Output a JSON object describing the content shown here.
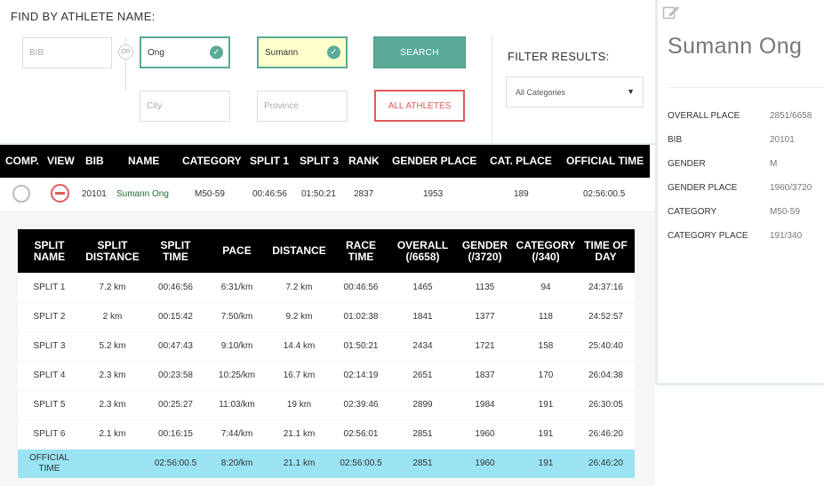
{
  "search": {
    "title": "FIND BY ATHLETE NAME:",
    "bib_placeholder": "BIB",
    "or_label": "OR",
    "last_name_value": "Ong",
    "first_name_value": "Sumann",
    "city_placeholder": "City",
    "province_placeholder": "Province",
    "search_button": "SEARCH",
    "all_athletes_button": "ALL ATHLETES"
  },
  "filter": {
    "title": "FILTER RESULTS:",
    "selected": "All Categories"
  },
  "results": {
    "headers": [
      "COMP.",
      "VIEW",
      "BIB",
      "NAME",
      "CATEGORY",
      "SPLIT 1",
      "SPLIT 3",
      "RANK",
      "GENDER PLACE",
      "CAT. PLACE",
      "OFFICIAL TIME"
    ],
    "row": {
      "bib": "20101",
      "name": "Sumann Ong",
      "category": "M50-59",
      "split1": "00:46:56",
      "split3": "01:50:21",
      "rank": "2837",
      "gender_place": "1953",
      "cat_place": "189",
      "official_time": "02:56:00.5"
    }
  },
  "splits": {
    "headers": [
      [
        "SPLIT",
        "NAME"
      ],
      [
        "SPLIT",
        "DISTANCE"
      ],
      [
        "SPLIT",
        "TIME"
      ],
      [
        "PACE"
      ],
      [
        "DISTANCE"
      ],
      [
        "RACE",
        "TIME"
      ],
      [
        "OVERALL",
        "(/6658)"
      ],
      [
        "GENDER",
        "(/3720)"
      ],
      [
        "CATEGORY",
        "(/340)"
      ],
      [
        "TIME OF",
        "DAY"
      ]
    ],
    "rows": [
      [
        "SPLIT 1",
        "7.2 km",
        "00:46:56",
        "6:31/km",
        "7.2 km",
        "00:46:56",
        "1465",
        "1135",
        "94",
        "24:37:16"
      ],
      [
        "SPLIT 2",
        "2 km",
        "00:15:42",
        "7:50/km",
        "9.2 km",
        "01:02:38",
        "1841",
        "1377",
        "118",
        "24:52:57"
      ],
      [
        "SPLIT 3",
        "5.2 km",
        "00:47:43",
        "9:10/km",
        "14.4 km",
        "01:50:21",
        "2434",
        "1721",
        "158",
        "25:40:40"
      ],
      [
        "SPLIT 4",
        "2.3 km",
        "00:23:58",
        "10:25/km",
        "16.7 km",
        "02:14:19",
        "2651",
        "1837",
        "170",
        "26:04:38"
      ],
      [
        "SPLIT 5",
        "2.3 km",
        "00:25:27",
        "11:03/km",
        "19 km",
        "02:39:46",
        "2899",
        "1984",
        "191",
        "26:30:05"
      ],
      [
        "SPLIT 6",
        "2.1 km",
        "00:16:15",
        "7:44/km",
        "21.1 km",
        "02:56:01",
        "2851",
        "1960",
        "191",
        "26:46:20"
      ]
    ],
    "official": [
      "OFFICIAL TIME",
      "",
      "02:56:00.5",
      "8:20/km",
      "21.1 km",
      "02:56:00.5",
      "2851",
      "1960",
      "191",
      "26:46:20"
    ]
  },
  "athlete": {
    "name": "Sumann Ong",
    "details": [
      {
        "label": "OVERALL PLACE",
        "value": "2851/6658"
      },
      {
        "label": "BIB",
        "value": "20101"
      },
      {
        "label": "GENDER",
        "value": "M"
      },
      {
        "label": "GENDER PLACE",
        "value": "1960/3720"
      },
      {
        "label": "CATEGORY",
        "value": "M50-59"
      },
      {
        "label": "CATEGORY PLACE",
        "value": "191/340"
      }
    ]
  },
  "colors": {
    "accent": "#5aaa98",
    "danger": "#e35a5a",
    "highlight": "#99e3f2",
    "name_link": "#1f6b2f"
  }
}
